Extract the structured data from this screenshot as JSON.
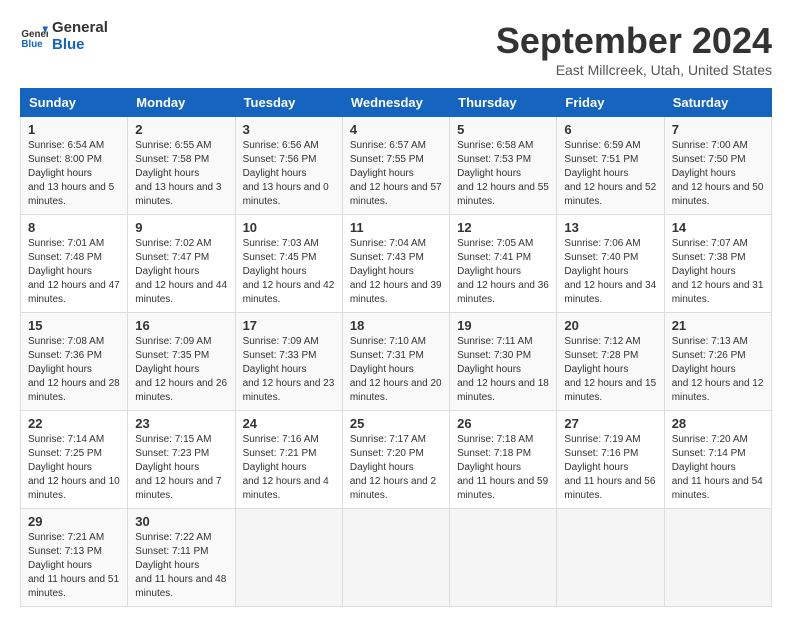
{
  "header": {
    "logo_general": "General",
    "logo_blue": "Blue",
    "month_title": "September 2024",
    "location": "East Millcreek, Utah, United States"
  },
  "days_of_week": [
    "Sunday",
    "Monday",
    "Tuesday",
    "Wednesday",
    "Thursday",
    "Friday",
    "Saturday"
  ],
  "weeks": [
    [
      {
        "day": "1",
        "sunrise": "6:54 AM",
        "sunset": "8:00 PM",
        "daylight": "13 hours and 5 minutes."
      },
      {
        "day": "2",
        "sunrise": "6:55 AM",
        "sunset": "7:58 PM",
        "daylight": "13 hours and 3 minutes."
      },
      {
        "day": "3",
        "sunrise": "6:56 AM",
        "sunset": "7:56 PM",
        "daylight": "13 hours and 0 minutes."
      },
      {
        "day": "4",
        "sunrise": "6:57 AM",
        "sunset": "7:55 PM",
        "daylight": "12 hours and 57 minutes."
      },
      {
        "day": "5",
        "sunrise": "6:58 AM",
        "sunset": "7:53 PM",
        "daylight": "12 hours and 55 minutes."
      },
      {
        "day": "6",
        "sunrise": "6:59 AM",
        "sunset": "7:51 PM",
        "daylight": "12 hours and 52 minutes."
      },
      {
        "day": "7",
        "sunrise": "7:00 AM",
        "sunset": "7:50 PM",
        "daylight": "12 hours and 50 minutes."
      }
    ],
    [
      {
        "day": "8",
        "sunrise": "7:01 AM",
        "sunset": "7:48 PM",
        "daylight": "12 hours and 47 minutes."
      },
      {
        "day": "9",
        "sunrise": "7:02 AM",
        "sunset": "7:47 PM",
        "daylight": "12 hours and 44 minutes."
      },
      {
        "day": "10",
        "sunrise": "7:03 AM",
        "sunset": "7:45 PM",
        "daylight": "12 hours and 42 minutes."
      },
      {
        "day": "11",
        "sunrise": "7:04 AM",
        "sunset": "7:43 PM",
        "daylight": "12 hours and 39 minutes."
      },
      {
        "day": "12",
        "sunrise": "7:05 AM",
        "sunset": "7:41 PM",
        "daylight": "12 hours and 36 minutes."
      },
      {
        "day": "13",
        "sunrise": "7:06 AM",
        "sunset": "7:40 PM",
        "daylight": "12 hours and 34 minutes."
      },
      {
        "day": "14",
        "sunrise": "7:07 AM",
        "sunset": "7:38 PM",
        "daylight": "12 hours and 31 minutes."
      }
    ],
    [
      {
        "day": "15",
        "sunrise": "7:08 AM",
        "sunset": "7:36 PM",
        "daylight": "12 hours and 28 minutes."
      },
      {
        "day": "16",
        "sunrise": "7:09 AM",
        "sunset": "7:35 PM",
        "daylight": "12 hours and 26 minutes."
      },
      {
        "day": "17",
        "sunrise": "7:09 AM",
        "sunset": "7:33 PM",
        "daylight": "12 hours and 23 minutes."
      },
      {
        "day": "18",
        "sunrise": "7:10 AM",
        "sunset": "7:31 PM",
        "daylight": "12 hours and 20 minutes."
      },
      {
        "day": "19",
        "sunrise": "7:11 AM",
        "sunset": "7:30 PM",
        "daylight": "12 hours and 18 minutes."
      },
      {
        "day": "20",
        "sunrise": "7:12 AM",
        "sunset": "7:28 PM",
        "daylight": "12 hours and 15 minutes."
      },
      {
        "day": "21",
        "sunrise": "7:13 AM",
        "sunset": "7:26 PM",
        "daylight": "12 hours and 12 minutes."
      }
    ],
    [
      {
        "day": "22",
        "sunrise": "7:14 AM",
        "sunset": "7:25 PM",
        "daylight": "12 hours and 10 minutes."
      },
      {
        "day": "23",
        "sunrise": "7:15 AM",
        "sunset": "7:23 PM",
        "daylight": "12 hours and 7 minutes."
      },
      {
        "day": "24",
        "sunrise": "7:16 AM",
        "sunset": "7:21 PM",
        "daylight": "12 hours and 4 minutes."
      },
      {
        "day": "25",
        "sunrise": "7:17 AM",
        "sunset": "7:20 PM",
        "daylight": "12 hours and 2 minutes."
      },
      {
        "day": "26",
        "sunrise": "7:18 AM",
        "sunset": "7:18 PM",
        "daylight": "11 hours and 59 minutes."
      },
      {
        "day": "27",
        "sunrise": "7:19 AM",
        "sunset": "7:16 PM",
        "daylight": "11 hours and 56 minutes."
      },
      {
        "day": "28",
        "sunrise": "7:20 AM",
        "sunset": "7:14 PM",
        "daylight": "11 hours and 54 minutes."
      }
    ],
    [
      {
        "day": "29",
        "sunrise": "7:21 AM",
        "sunset": "7:13 PM",
        "daylight": "11 hours and 51 minutes."
      },
      {
        "day": "30",
        "sunrise": "7:22 AM",
        "sunset": "7:11 PM",
        "daylight": "11 hours and 48 minutes."
      },
      null,
      null,
      null,
      null,
      null
    ]
  ]
}
